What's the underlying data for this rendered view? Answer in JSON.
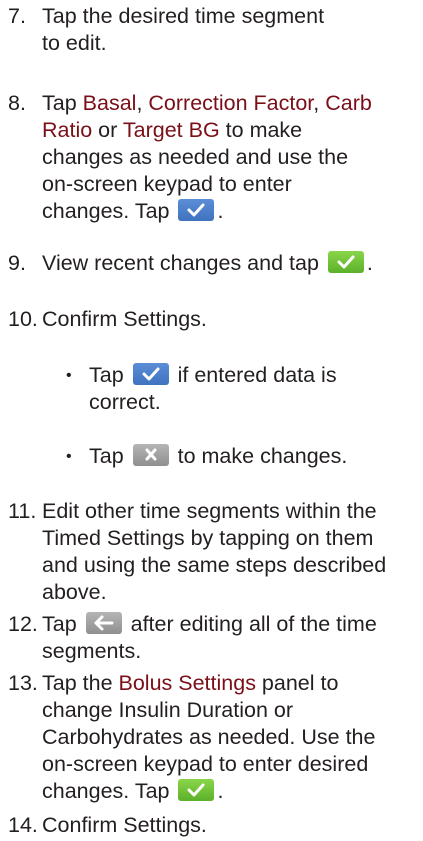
{
  "steps": [
    {
      "num": "7.",
      "text": "Tap the desired time segment to edit."
    },
    {
      "num": "8.",
      "pre": "Tap ",
      "kw1": "Basal",
      "sep1": ", ",
      "kw2": "Correction Factor",
      "sep2": ", ",
      "kw3": "Carb Ratio",
      "sep3": " or ",
      "kw4": "Target BG",
      "post": " to make changes as needed and use the on-screen keypad to enter changes. Tap ",
      "end": "."
    },
    {
      "num": "9.",
      "pre": "View recent changes and tap ",
      "end": "."
    },
    {
      "num": "10.",
      "text": "Confirm Settings."
    },
    {
      "num": "11.",
      "text": "Edit other time segments within the Timed Settings by tapping on them and using the same steps described above."
    },
    {
      "num": "12.",
      "pre": "Tap ",
      "post": " after editing all of the time segments."
    },
    {
      "num": "13.",
      "pre": "Tap the ",
      "kw": "Bolus Settings",
      "post": " panel to change Insulin Duration or Carbohydrates as needed. Use the on-screen keypad to enter desired changes. Tap ",
      "end": "."
    },
    {
      "num": "14.",
      "text": "Confirm Settings."
    }
  ],
  "bullets": [
    {
      "dot": "•",
      "pre": "Tap ",
      "post": " if entered data is correct."
    },
    {
      "dot": "•",
      "pre": "Tap ",
      "post": " to make changes."
    }
  ],
  "icons": {
    "check_blue": "check-icon",
    "check_green": "check-icon",
    "x_gray": "close-icon",
    "back_gray": "back-arrow-icon"
  },
  "colors": {
    "keyword": "#7a0f18",
    "button_blue": "#4a7fcb",
    "button_green": "#74c33a",
    "button_gray": "#a3a3a3"
  }
}
